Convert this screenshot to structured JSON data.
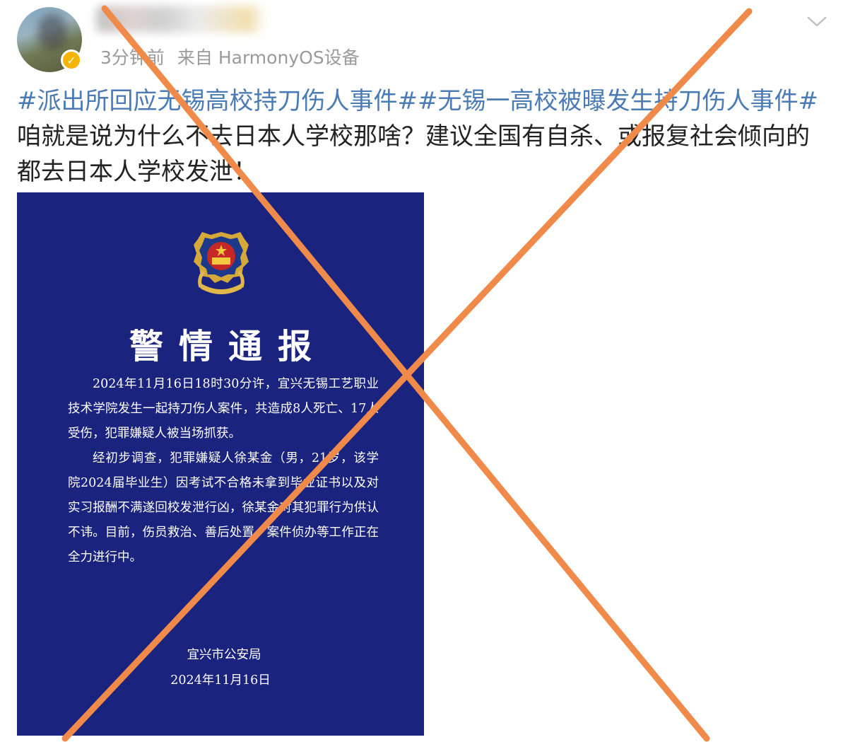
{
  "post": {
    "username_fragment": "...nine",
    "time": "3分钟前",
    "source": "来自 HarmonyOS设备",
    "hashtag1": "#派出所回应无锡高校持刀伤人事件#",
    "hashtag2": "#无锡一高校被曝发生持刀伤人事件#",
    "body": "咱就是说为什么不去日本人学校那啥？建议全国有自杀、或报复社会倾向的都去日本人学校发泄！"
  },
  "notice": {
    "title": "警情通报",
    "paragraph1": "2024年11月16日18时30分许，宜兴无锡工艺职业技术学院发生一起持刀伤人案件，共造成8人死亡、17人受伤，犯罪嫌疑人被当场抓获。",
    "paragraph2": "经初步调查，犯罪嫌疑人徐某金（男，21岁，该学院2024届毕业生）因考试不合格未拿到毕业证书以及对实习报酬不满遂回校发泄行凶，徐某金对其犯罪行为供认不讳。目前，伤员救治、善后处置、案件侦办等工作正在全力进行中。",
    "issuer": "宜兴市公安局",
    "date": "2024年11月16日"
  },
  "icons": {
    "verified": "verified-badge-icon",
    "menu": "chevron-down-icon",
    "emblem": "police-emblem-icon",
    "cross": "red-cross-mark"
  },
  "colors": {
    "hashtag": "#4a7bb5",
    "notice_bg": "#1a237e",
    "cross": "#f08a4b"
  }
}
